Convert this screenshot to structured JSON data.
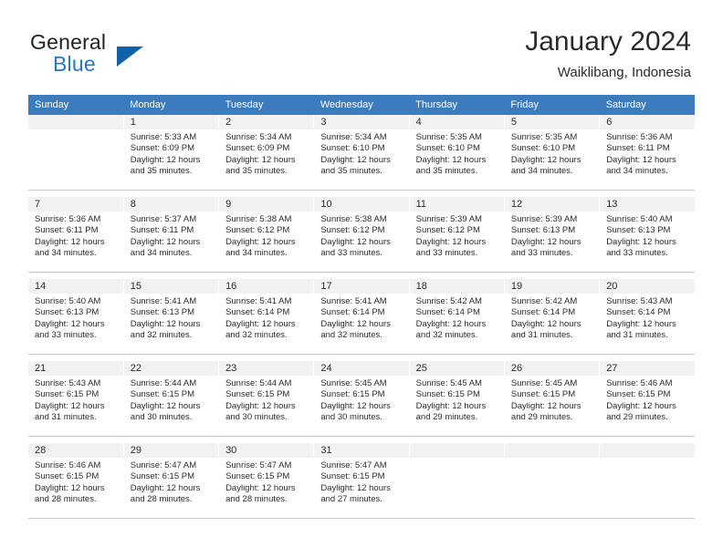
{
  "brand": {
    "name_top": "General",
    "name_bottom": "Blue",
    "triangle_color": "#1161a8",
    "blue_color": "#2277c8"
  },
  "header": {
    "title": "January 2024",
    "subtitle": "Waiklibang, Indonesia"
  },
  "theme": {
    "header_row_bg": "#3a7cbe",
    "daynum_bg": "#f2f2f2",
    "text_color": "#2b2b2b",
    "grid_line": "#c8c8c8"
  },
  "weekday_headers": [
    "Sunday",
    "Monday",
    "Tuesday",
    "Wednesday",
    "Thursday",
    "Friday",
    "Saturday"
  ],
  "weeks": [
    [
      {
        "day": "",
        "sunrise": "",
        "sunset": "",
        "daylight1": "",
        "daylight2": ""
      },
      {
        "day": "1",
        "sunrise": "Sunrise: 5:33 AM",
        "sunset": "Sunset: 6:09 PM",
        "daylight1": "Daylight: 12 hours",
        "daylight2": "and 35 minutes."
      },
      {
        "day": "2",
        "sunrise": "Sunrise: 5:34 AM",
        "sunset": "Sunset: 6:09 PM",
        "daylight1": "Daylight: 12 hours",
        "daylight2": "and 35 minutes."
      },
      {
        "day": "3",
        "sunrise": "Sunrise: 5:34 AM",
        "sunset": "Sunset: 6:10 PM",
        "daylight1": "Daylight: 12 hours",
        "daylight2": "and 35 minutes."
      },
      {
        "day": "4",
        "sunrise": "Sunrise: 5:35 AM",
        "sunset": "Sunset: 6:10 PM",
        "daylight1": "Daylight: 12 hours",
        "daylight2": "and 35 minutes."
      },
      {
        "day": "5",
        "sunrise": "Sunrise: 5:35 AM",
        "sunset": "Sunset: 6:10 PM",
        "daylight1": "Daylight: 12 hours",
        "daylight2": "and 34 minutes."
      },
      {
        "day": "6",
        "sunrise": "Sunrise: 5:36 AM",
        "sunset": "Sunset: 6:11 PM",
        "daylight1": "Daylight: 12 hours",
        "daylight2": "and 34 minutes."
      }
    ],
    [
      {
        "day": "7",
        "sunrise": "Sunrise: 5:36 AM",
        "sunset": "Sunset: 6:11 PM",
        "daylight1": "Daylight: 12 hours",
        "daylight2": "and 34 minutes."
      },
      {
        "day": "8",
        "sunrise": "Sunrise: 5:37 AM",
        "sunset": "Sunset: 6:11 PM",
        "daylight1": "Daylight: 12 hours",
        "daylight2": "and 34 minutes."
      },
      {
        "day": "9",
        "sunrise": "Sunrise: 5:38 AM",
        "sunset": "Sunset: 6:12 PM",
        "daylight1": "Daylight: 12 hours",
        "daylight2": "and 34 minutes."
      },
      {
        "day": "10",
        "sunrise": "Sunrise: 5:38 AM",
        "sunset": "Sunset: 6:12 PM",
        "daylight1": "Daylight: 12 hours",
        "daylight2": "and 33 minutes."
      },
      {
        "day": "11",
        "sunrise": "Sunrise: 5:39 AM",
        "sunset": "Sunset: 6:12 PM",
        "daylight1": "Daylight: 12 hours",
        "daylight2": "and 33 minutes."
      },
      {
        "day": "12",
        "sunrise": "Sunrise: 5:39 AM",
        "sunset": "Sunset: 6:13 PM",
        "daylight1": "Daylight: 12 hours",
        "daylight2": "and 33 minutes."
      },
      {
        "day": "13",
        "sunrise": "Sunrise: 5:40 AM",
        "sunset": "Sunset: 6:13 PM",
        "daylight1": "Daylight: 12 hours",
        "daylight2": "and 33 minutes."
      }
    ],
    [
      {
        "day": "14",
        "sunrise": "Sunrise: 5:40 AM",
        "sunset": "Sunset: 6:13 PM",
        "daylight1": "Daylight: 12 hours",
        "daylight2": "and 33 minutes."
      },
      {
        "day": "15",
        "sunrise": "Sunrise: 5:41 AM",
        "sunset": "Sunset: 6:13 PM",
        "daylight1": "Daylight: 12 hours",
        "daylight2": "and 32 minutes."
      },
      {
        "day": "16",
        "sunrise": "Sunrise: 5:41 AM",
        "sunset": "Sunset: 6:14 PM",
        "daylight1": "Daylight: 12 hours",
        "daylight2": "and 32 minutes."
      },
      {
        "day": "17",
        "sunrise": "Sunrise: 5:41 AM",
        "sunset": "Sunset: 6:14 PM",
        "daylight1": "Daylight: 12 hours",
        "daylight2": "and 32 minutes."
      },
      {
        "day": "18",
        "sunrise": "Sunrise: 5:42 AM",
        "sunset": "Sunset: 6:14 PM",
        "daylight1": "Daylight: 12 hours",
        "daylight2": "and 32 minutes."
      },
      {
        "day": "19",
        "sunrise": "Sunrise: 5:42 AM",
        "sunset": "Sunset: 6:14 PM",
        "daylight1": "Daylight: 12 hours",
        "daylight2": "and 31 minutes."
      },
      {
        "day": "20",
        "sunrise": "Sunrise: 5:43 AM",
        "sunset": "Sunset: 6:14 PM",
        "daylight1": "Daylight: 12 hours",
        "daylight2": "and 31 minutes."
      }
    ],
    [
      {
        "day": "21",
        "sunrise": "Sunrise: 5:43 AM",
        "sunset": "Sunset: 6:15 PM",
        "daylight1": "Daylight: 12 hours",
        "daylight2": "and 31 minutes."
      },
      {
        "day": "22",
        "sunrise": "Sunrise: 5:44 AM",
        "sunset": "Sunset: 6:15 PM",
        "daylight1": "Daylight: 12 hours",
        "daylight2": "and 30 minutes."
      },
      {
        "day": "23",
        "sunrise": "Sunrise: 5:44 AM",
        "sunset": "Sunset: 6:15 PM",
        "daylight1": "Daylight: 12 hours",
        "daylight2": "and 30 minutes."
      },
      {
        "day": "24",
        "sunrise": "Sunrise: 5:45 AM",
        "sunset": "Sunset: 6:15 PM",
        "daylight1": "Daylight: 12 hours",
        "daylight2": "and 30 minutes."
      },
      {
        "day": "25",
        "sunrise": "Sunrise: 5:45 AM",
        "sunset": "Sunset: 6:15 PM",
        "daylight1": "Daylight: 12 hours",
        "daylight2": "and 29 minutes."
      },
      {
        "day": "26",
        "sunrise": "Sunrise: 5:45 AM",
        "sunset": "Sunset: 6:15 PM",
        "daylight1": "Daylight: 12 hours",
        "daylight2": "and 29 minutes."
      },
      {
        "day": "27",
        "sunrise": "Sunrise: 5:46 AM",
        "sunset": "Sunset: 6:15 PM",
        "daylight1": "Daylight: 12 hours",
        "daylight2": "and 29 minutes."
      }
    ],
    [
      {
        "day": "28",
        "sunrise": "Sunrise: 5:46 AM",
        "sunset": "Sunset: 6:15 PM",
        "daylight1": "Daylight: 12 hours",
        "daylight2": "and 28 minutes."
      },
      {
        "day": "29",
        "sunrise": "Sunrise: 5:47 AM",
        "sunset": "Sunset: 6:15 PM",
        "daylight1": "Daylight: 12 hours",
        "daylight2": "and 28 minutes."
      },
      {
        "day": "30",
        "sunrise": "Sunrise: 5:47 AM",
        "sunset": "Sunset: 6:15 PM",
        "daylight1": "Daylight: 12 hours",
        "daylight2": "and 28 minutes."
      },
      {
        "day": "31",
        "sunrise": "Sunrise: 5:47 AM",
        "sunset": "Sunset: 6:15 PM",
        "daylight1": "Daylight: 12 hours",
        "daylight2": "and 27 minutes."
      },
      {
        "day": "",
        "sunrise": "",
        "sunset": "",
        "daylight1": "",
        "daylight2": ""
      },
      {
        "day": "",
        "sunrise": "",
        "sunset": "",
        "daylight1": "",
        "daylight2": ""
      },
      {
        "day": "",
        "sunrise": "",
        "sunset": "",
        "daylight1": "",
        "daylight2": ""
      }
    ]
  ]
}
